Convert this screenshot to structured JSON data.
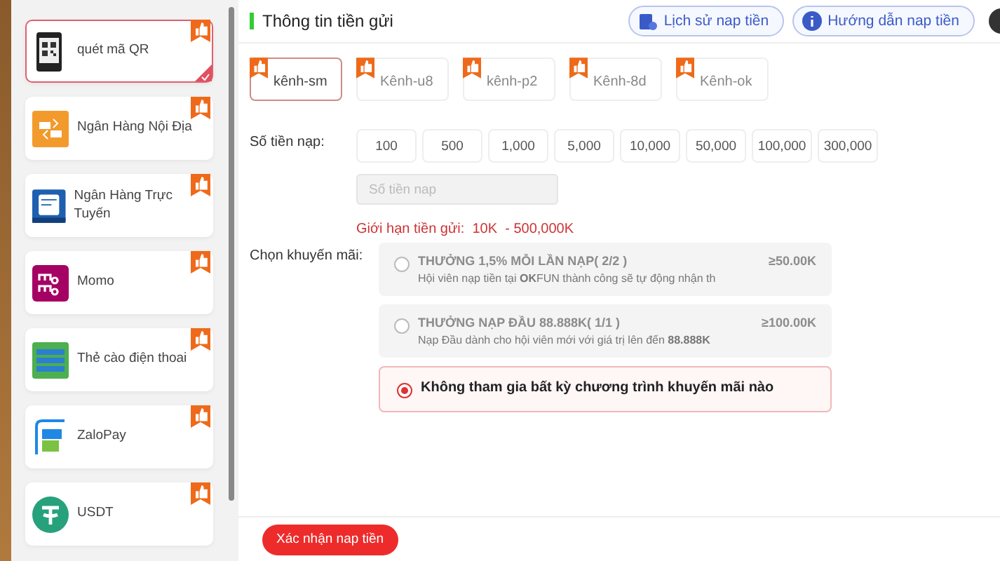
{
  "sidebar": {
    "items": [
      {
        "label": "quét mã QR",
        "kind": "qr",
        "selected": true
      },
      {
        "label": "Ngân Hàng Nội Địa",
        "kind": "bank",
        "selected": false
      },
      {
        "label": "Ngân Hàng Trực Tuyến",
        "kind": "online",
        "selected": false
      },
      {
        "label": "Momo",
        "kind": "momo",
        "selected": false
      },
      {
        "label": "Thẻ cào điện thoai",
        "kind": "card",
        "selected": false
      },
      {
        "label": "ZaloPay",
        "kind": "zalopay",
        "selected": false
      },
      {
        "label": "USDT",
        "kind": "usdt",
        "selected": false
      }
    ]
  },
  "header": {
    "title": "Thông tin tiền gửi",
    "buttons": [
      {
        "label": "Lịch sử nap tiền",
        "kind": "history"
      },
      {
        "label": "Hướng dẫn nap tiền",
        "kind": "info"
      }
    ]
  },
  "channels": [
    {
      "label": "kênh-sm",
      "selected": true
    },
    {
      "label": "Kênh-u8",
      "selected": false
    },
    {
      "label": "kênh-p2",
      "selected": false
    },
    {
      "label": "Kênh-8d",
      "selected": false
    },
    {
      "label": "Kênh-ok",
      "selected": false
    }
  ],
  "amount": {
    "label": "Số tiền nạp:",
    "presets": [
      "100",
      "500",
      "1,000",
      "5,000",
      "10,000",
      "50,000",
      "100,000",
      "300,000"
    ],
    "placeholder": "Số tiền nap",
    "limit": "Giới hạn tiền gửi:  10K  - 500,000K"
  },
  "promotions": {
    "label": "Chọn khuyến mãi:",
    "items": [
      {
        "title": "THƯỞNG 1,5% MỖI LẦN NẠP( 2/2 )",
        "description": "Hội viên nạp tiền tại **OK**FUN thành công sẽ tự động nhận th",
        "minimum": "≥50.00K",
        "disabled": true,
        "selected": false
      },
      {
        "title": "THƯỞNG NẠP ĐẦU 88.888K( 1/1 )",
        "description": "Nạp Đầu dành cho hội viên mới với giá trị lên đến **88.888K**",
        "minimum": "≥100.00K",
        "disabled": true,
        "selected": false
      },
      {
        "title": "Không tham gia bất kỳ chương trình khuyến mãi nào",
        "disabled": false,
        "selected": true
      }
    ]
  },
  "footer": {
    "confirm": "Xác nhận nap tiền"
  }
}
